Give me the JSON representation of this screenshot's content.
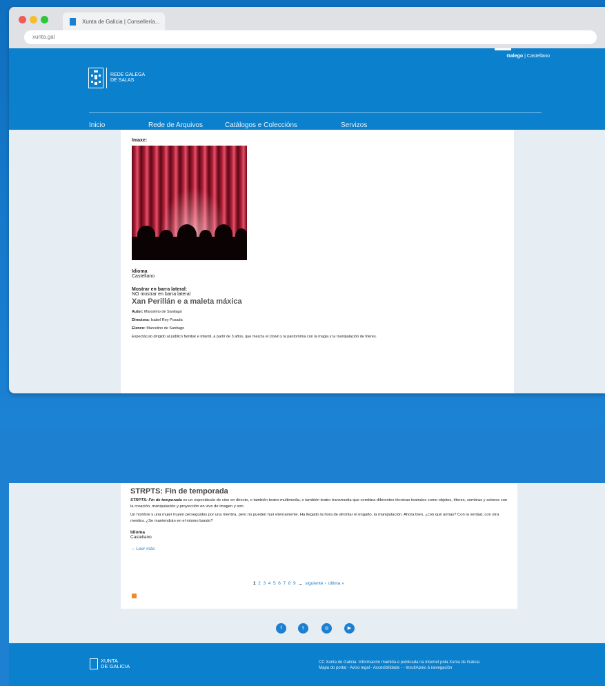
{
  "browser": {
    "tab_title": "Xunta de Galicia | Consellería...",
    "url": "xunta.gal"
  },
  "header": {
    "lang_active": "Galego",
    "lang_sep": " | ",
    "lang_other": "Castellano",
    "logo_line1": "REDE GALEGA",
    "logo_line2": "DE SALAS",
    "nav": [
      "Inicio",
      "Rede de Arquivos",
      "Catálogos e Coleccións",
      "Servizos"
    ]
  },
  "entry1": {
    "image_label": "Imaxe:",
    "idioma_label": "Idioma",
    "idioma_value": "Castellano",
    "sidebar_label": "Mostrar en barra lateral:",
    "sidebar_value": "NO mostrar en barra lateral",
    "title": "Xan Perillán e a maleta máxica",
    "autor_label": "Autor:",
    "autor_value": " Marcelino de Santiago",
    "directora_label": "Directora:",
    "directora_value": " Isabel Rey Posada",
    "elenco_label": "Elenco:",
    "elenco_value": " Marcelino de Santiago",
    "description": "Espectáculo dirigido al público familiar e infantil, a partir de 3 años, que mezcla el clown y la pantomima con la magia y la manipulación de títeres."
  },
  "entry2": {
    "title": "STRPTS: Fin de temporada",
    "para1_em": "STRPTS: Fin de temporada",
    "para1_rest": " es un espectáculo de cine en directo, o también teatro multimedia, o también teatro transmedia que combina diferentes técnicas teatrales como objetos, títeres, sombras y actores con la creación, manipulación y proyección en vivo de imagen y son.",
    "para2": "Un hombre y una mujer huyen perseguidos por una mentira, pero no pueden huir eternamente. Ha llegado la hora de afrontar el engaño, la manipulación. Ahora bien, ¿con qué armas? Con la verdad, con otra mentira. ¿Se mantendrán en el mismo bando?",
    "idioma_label": "Idioma",
    "idioma_value": "Castellano",
    "read_more": "→ Leer más"
  },
  "pager": {
    "current": "1",
    "pages": [
      "2",
      "3",
      "4",
      "5",
      "6",
      "7",
      "8",
      "9"
    ],
    "ellipsis": "…",
    "next": "siguiente ›",
    "last": "última »"
  },
  "social": [
    "f",
    "t",
    "◎",
    "▶"
  ],
  "footer": {
    "logo_line1": "XUNTA",
    "logo_line2": "DE GALICIA",
    "line1": "CC Xunta de Galicia. Información mantida e publicada na internet pola Xunta de Galicia",
    "line2": "Mapa do portal - Aviso legal - Accesibilidade -  - InsuitApoio á navegación"
  }
}
